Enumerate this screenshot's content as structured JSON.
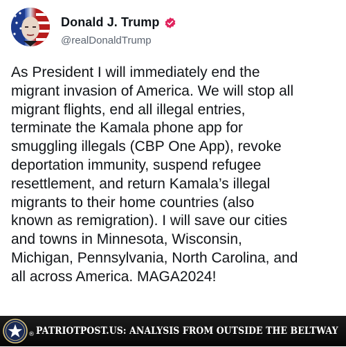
{
  "post": {
    "author": {
      "name": "Donald J. Trump",
      "handle": "@realDonaldTrump",
      "verified": true
    },
    "text": "As President I will immediately end the\nmigrant invasion of America. We will stop all\nmigrant flights, end all illegal entries,\nterminate the Kamala phone app for\nsmuggling illegals (CBP One App), revoke\ndeportation immunity, suspend refugee\nresettlement, and return Kamala’s illegal\nmigrants to their home countries (also\nknown as remigration). I will save our cities\nand towns in Minnesota, Wisconsin,\nMichigan, Pennsylvania, North Carolina, and\nall across America. MAGA2024!"
  },
  "footer": {
    "registered_mark": "®",
    "text": "PATRIOTPOST.US: ANALYSIS FROM OUTSIDE THE BELTWAY"
  },
  "colors": {
    "verified_badge": "#e0245e",
    "text": "#111418",
    "handle": "#5b6470",
    "footer_bg": "#050505"
  },
  "icons": {
    "avatar": "avatar-image",
    "verified": "verified-badge-icon",
    "footer_logo": "star-seal-icon"
  }
}
